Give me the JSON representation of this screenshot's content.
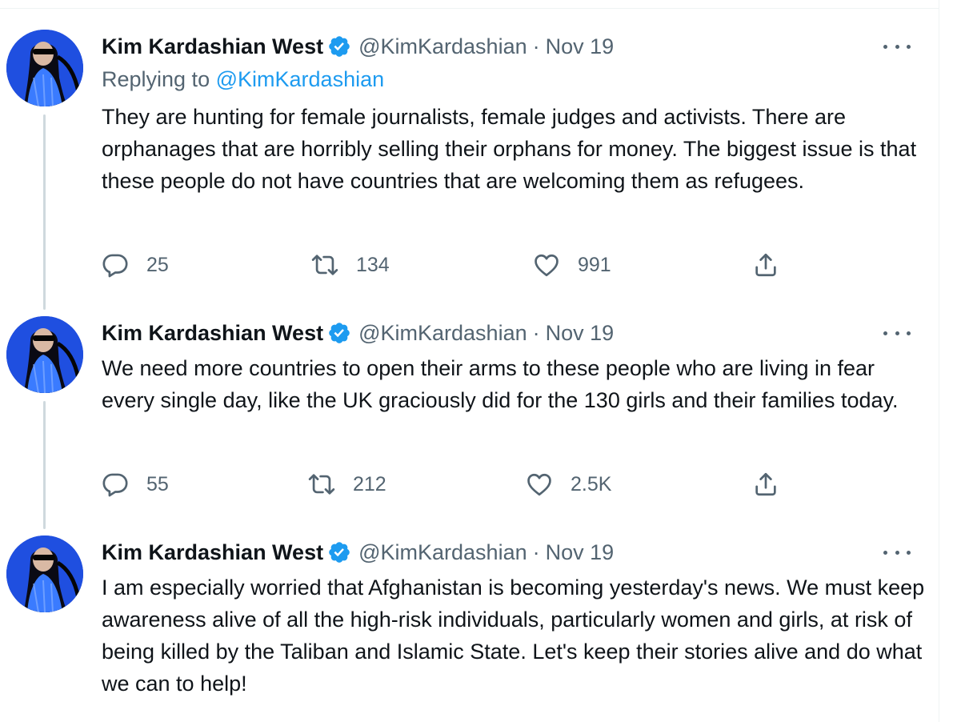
{
  "colors": {
    "primary_text": "#0f1419",
    "secondary_text": "#536471",
    "link": "#1d9bf0",
    "verified_badge": "#1d9bf0",
    "thread_line": "#cfd9de"
  },
  "tweets": [
    {
      "author": {
        "name": "Kim Kardashian West",
        "handle": "@KimKardashian",
        "verified": true,
        "verified_icon": "verified-badge-icon",
        "avatar_icon": "profile-avatar"
      },
      "separator": "·",
      "date": "Nov 19",
      "replying_prefix": "Replying to",
      "replying_to": "@KimKardashian",
      "text": "They are hunting for female journalists, female judges and activists. There are orphanages that are horribly selling their orphans for money. The biggest issue is that these people do not have countries that are welcoming them as refugees.",
      "actions": {
        "replies": "25",
        "retweets": "134",
        "likes": "991"
      }
    },
    {
      "author": {
        "name": "Kim Kardashian West",
        "handle": "@KimKardashian",
        "verified": true,
        "verified_icon": "verified-badge-icon",
        "avatar_icon": "profile-avatar"
      },
      "separator": "·",
      "date": "Nov 19",
      "text": "We need more countries to open their arms to these people who are living in fear every single day, like the UK graciously did for the 130 girls and their families today.",
      "actions": {
        "replies": "55",
        "retweets": "212",
        "likes": "2.5K"
      }
    },
    {
      "author": {
        "name": "Kim Kardashian West",
        "handle": "@KimKardashian",
        "verified": true,
        "verified_icon": "verified-badge-icon",
        "avatar_icon": "profile-avatar"
      },
      "separator": "·",
      "date": "Nov 19",
      "text": "I am especially worried that Afghanistan is becoming yesterday's news. We must keep awareness alive of all the high-risk individuals, particularly women and girls, at risk of being killed by the Taliban and Islamic State. Let's keep their stories alive and do what we can to help!"
    }
  ],
  "icons": {
    "reply": "reply-icon",
    "retweet": "retweet-icon",
    "like": "like-icon",
    "share": "share-icon",
    "more": "more-options-icon"
  }
}
